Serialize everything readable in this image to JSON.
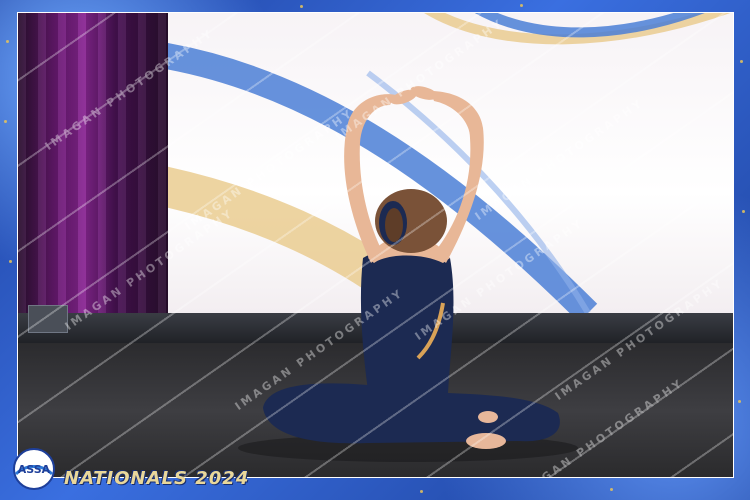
{
  "event": {
    "title": "NATIONALS 2024",
    "logo_text": "ASSA"
  },
  "watermark": {
    "text": "IMAGAN PHOTOGRAPHY"
  },
  "colors": {
    "frame_blue": "#2a55b8",
    "gold": "#e7c45a",
    "costume_navy": "#1c2a52",
    "screen_ribbon_blue": "#4b7fd6",
    "screen_ribbon_gold": "#e8c98a"
  },
  "icons": [
    "assa-logo-icon"
  ]
}
